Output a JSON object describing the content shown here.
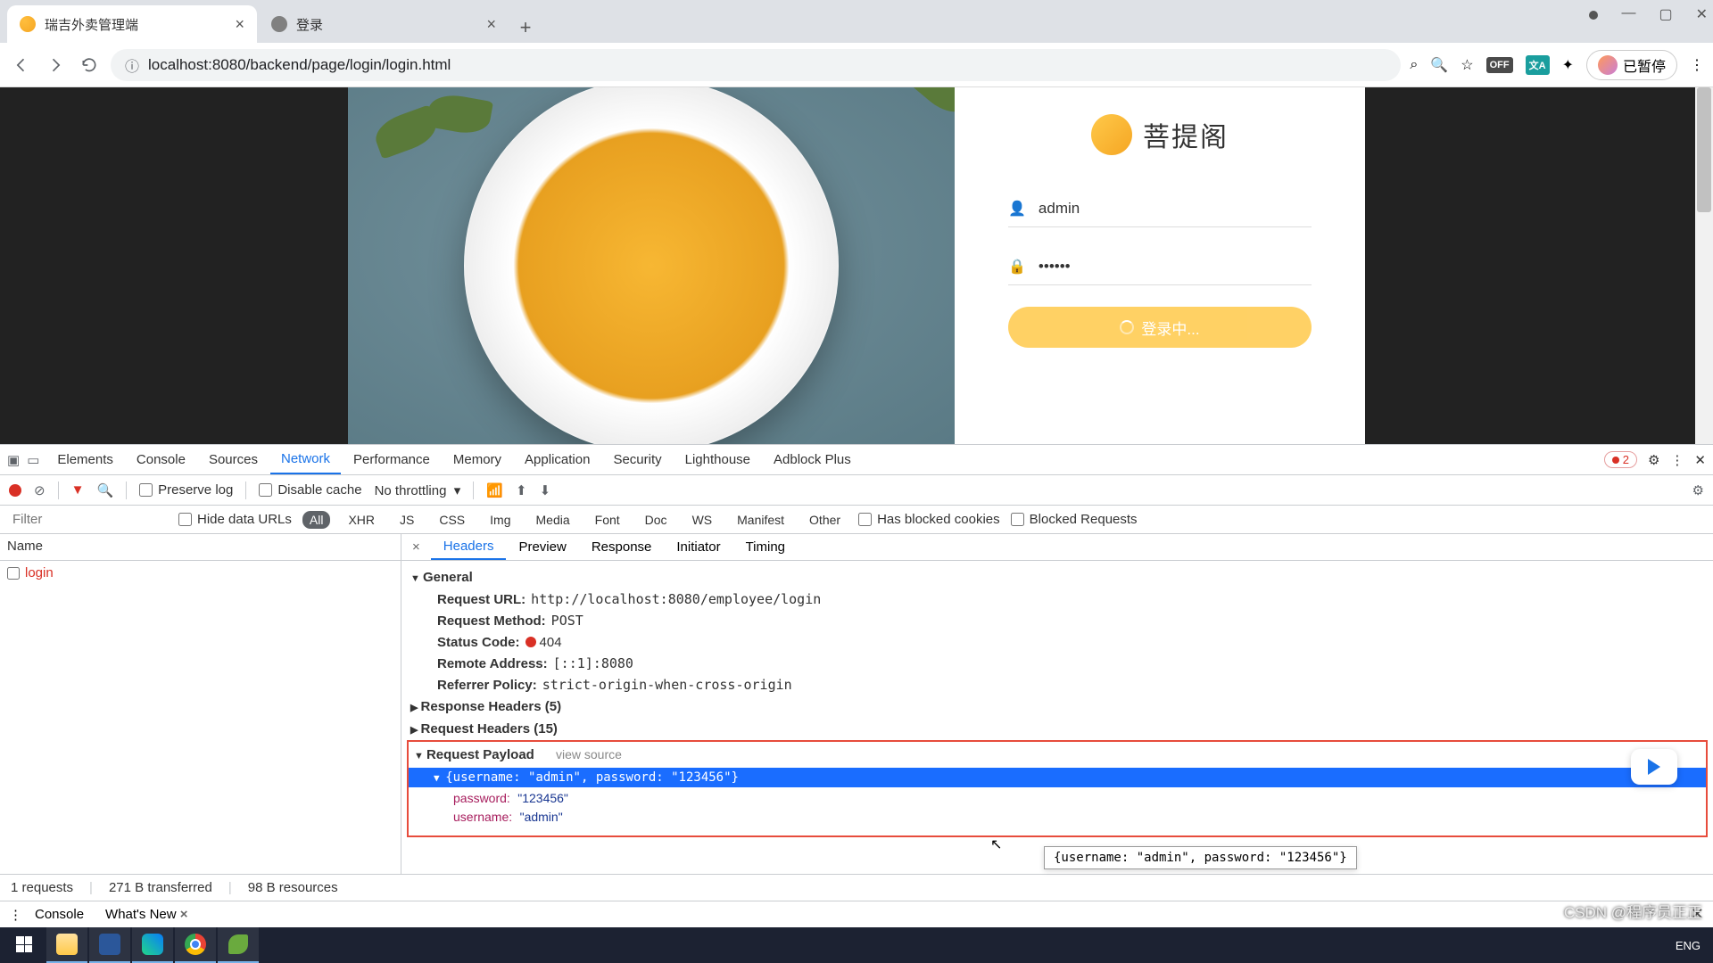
{
  "browser": {
    "tabs": [
      {
        "title": "瑞吉外卖管理端",
        "active": true
      },
      {
        "title": "登录",
        "active": false
      }
    ],
    "url": "localhost:8080/backend/page/login/login.html",
    "profile_status": "已暂停"
  },
  "login": {
    "brand_text": "菩提阁",
    "username_value": "admin",
    "password_masked": "••••••",
    "button_label": "登录中..."
  },
  "devtools": {
    "tabs": [
      "Elements",
      "Console",
      "Sources",
      "Network",
      "Performance",
      "Memory",
      "Application",
      "Security",
      "Lighthouse",
      "Adblock Plus"
    ],
    "active_tab": "Network",
    "error_count": "2",
    "toolbar": {
      "preserve_log": "Preserve log",
      "disable_cache": "Disable cache",
      "throttling": "No throttling"
    },
    "filter": {
      "placeholder": "Filter",
      "hide_data_urls": "Hide data URLs",
      "types": [
        "All",
        "XHR",
        "JS",
        "CSS",
        "Img",
        "Media",
        "Font",
        "Doc",
        "WS",
        "Manifest",
        "Other"
      ],
      "active_type": "All",
      "has_blocked_cookies": "Has blocked cookies",
      "blocked_requests": "Blocked Requests"
    },
    "requests": {
      "header": "Name",
      "rows": [
        "login"
      ]
    },
    "detail_tabs": [
      "Headers",
      "Preview",
      "Response",
      "Initiator",
      "Timing"
    ],
    "active_detail_tab": "Headers",
    "general": {
      "title": "General",
      "request_url_k": "Request URL:",
      "request_url_v": "http://localhost:8080/employee/login",
      "request_method_k": "Request Method:",
      "request_method_v": "POST",
      "status_code_k": "Status Code:",
      "status_code_v": "404",
      "remote_addr_k": "Remote Address:",
      "remote_addr_v": "[::1]:8080",
      "referrer_k": "Referrer Policy:",
      "referrer_v": "strict-origin-when-cross-origin"
    },
    "response_headers": "Response Headers (5)",
    "request_headers": "Request Headers (15)",
    "payload": {
      "title": "Request Payload",
      "view_source": "view source",
      "summary": "{username: \"admin\", password: \"123456\"}",
      "rows": [
        {
          "k": "password:",
          "v": "\"123456\""
        },
        {
          "k": "username:",
          "v": "\"admin\""
        }
      ],
      "tooltip": "{username: \"admin\", password: \"123456\"}"
    },
    "status_bar": {
      "requests": "1 requests",
      "transferred": "271 B transferred",
      "resources": "98 B resources"
    },
    "drawer": {
      "console": "Console",
      "whatsnew": "What's New"
    }
  },
  "tray": {
    "lang": "ENG"
  },
  "watermark": "CSDN @程序员正正"
}
